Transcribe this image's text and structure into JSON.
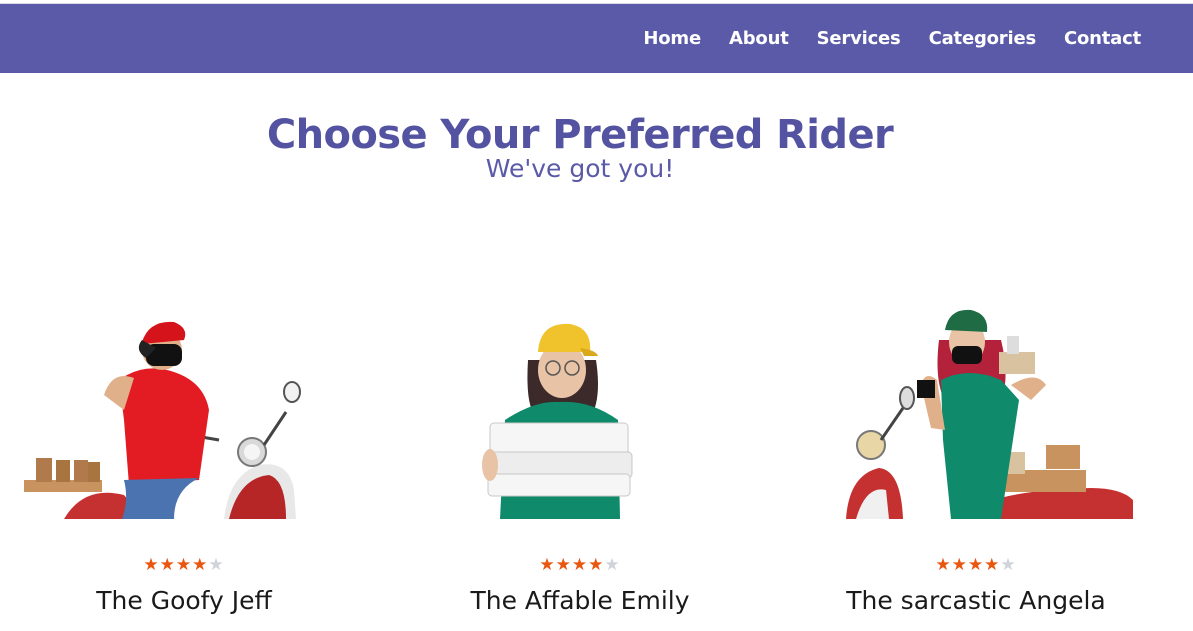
{
  "nav": {
    "items": [
      {
        "label": "Home"
      },
      {
        "label": "About"
      },
      {
        "label": "Services"
      },
      {
        "label": "Categories"
      },
      {
        "label": "Contact"
      }
    ]
  },
  "hero": {
    "title": "Choose Your Preferred Rider",
    "subtitle": "We've got you!"
  },
  "riders": [
    {
      "name": "The Goofy Jeff",
      "rating": 4,
      "max_rating": 5
    },
    {
      "name": "The Affable Emily",
      "rating": 4,
      "max_rating": 5
    },
    {
      "name": "The sarcastic Angela",
      "rating": 4,
      "max_rating": 5
    }
  ],
  "colors": {
    "nav_bg": "#5b5aa8",
    "accent": "#5453a1",
    "star_on": "#e8560f",
    "star_off": "#cfd3da"
  }
}
